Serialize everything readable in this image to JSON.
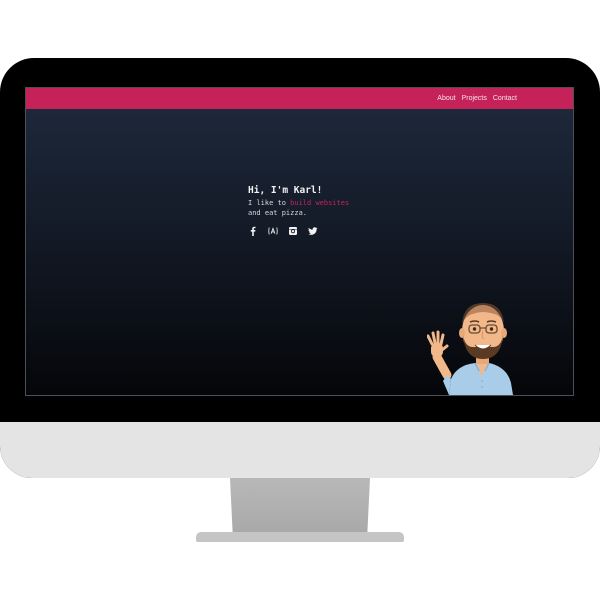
{
  "nav": {
    "links": [
      {
        "label": "About"
      },
      {
        "label": "Projects"
      },
      {
        "label": "Contact"
      }
    ]
  },
  "hero": {
    "greeting": "Hi, I'm Karl!",
    "line1_prefix": "I like to ",
    "line1_accent": "build websites",
    "line2": "and eat pizza."
  },
  "socials": [
    {
      "icon": "facebook-icon"
    },
    {
      "icon": "codepen-icon"
    },
    {
      "icon": "instagram-icon"
    },
    {
      "icon": "twitter-icon"
    }
  ],
  "colors": {
    "accent": "#c6225a",
    "background_top": "#1f2a3d",
    "background_bottom": "#050609"
  }
}
